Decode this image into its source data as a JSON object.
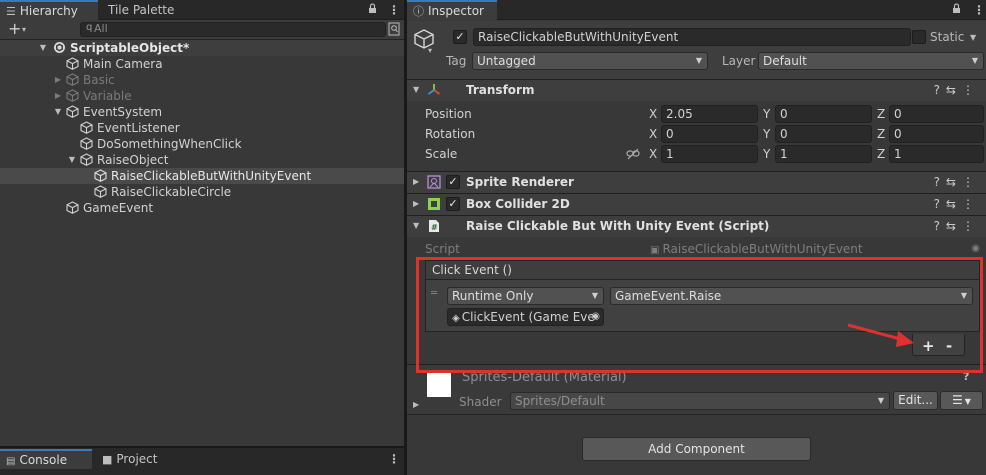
{
  "hierarchy": {
    "tabs": [
      {
        "label": "Hierarchy"
      },
      {
        "label": "Tile Palette"
      }
    ],
    "add_button": "+",
    "add_arrow": "▾",
    "search_prefix": "q",
    "search_placeholder": "All",
    "items": [
      {
        "label": "ScriptableObject*"
      },
      {
        "label": "Main Camera"
      },
      {
        "label": "Basic"
      },
      {
        "label": "Variable"
      },
      {
        "label": "EventSystem"
      },
      {
        "label": "EventListener"
      },
      {
        "label": "DoSomethingWhenClick"
      },
      {
        "label": "RaiseObject"
      },
      {
        "label": "RaiseClickableButWithUnityEvent"
      },
      {
        "label": "RaiseClickableCircle"
      },
      {
        "label": "GameEvent"
      }
    ]
  },
  "console": {
    "tabs": [
      {
        "label": "Console"
      },
      {
        "label": "Project"
      }
    ]
  },
  "inspector": {
    "tab_label": "Inspector",
    "object_name": "RaiseClickableButWithUnityEvent",
    "static_label": "Static",
    "tag_label": "Tag",
    "tag_value": "Untagged",
    "layer_label": "Layer",
    "layer_value": "Default",
    "check_mark": "✓",
    "transform": {
      "title": "Transform",
      "position_label": "Position",
      "rotation_label": "Rotation",
      "scale_label": "Scale",
      "axis_x": "X",
      "axis_y": "Y",
      "axis_z": "Z",
      "position": {
        "x": "2.05",
        "y": "0",
        "z": "0"
      },
      "rotation": {
        "x": "0",
        "y": "0",
        "z": "0"
      },
      "scale": {
        "x": "1",
        "y": "1",
        "z": "1"
      }
    },
    "sprite_renderer_title": "Sprite Renderer",
    "box_collider_title": "Box Collider 2D",
    "script_component": {
      "title": "Raise Clickable But With Unity Event (Script)",
      "script_label": "Script",
      "script_value": "RaiseClickableButWithUnityEvent",
      "event_header": "Click Event ()",
      "runtime_option": "Runtime Only",
      "function_value": "GameEvent.Raise",
      "object_field": "ClickEvent (Game Eve",
      "add_label": "+",
      "remove_label": "-"
    },
    "material": {
      "name": "Sprites-Default (Material)",
      "shader_label": "Shader",
      "shader_value": "Sprites/Default",
      "edit_label": "Edit...",
      "list_icon": "☰"
    },
    "add_component_label": "Add Component"
  },
  "colors": {
    "highlight_box": "#e03131",
    "annotation_arrow": "#e03131",
    "selection": "#4a4a4a",
    "tab_accent": "#3a79bb"
  }
}
